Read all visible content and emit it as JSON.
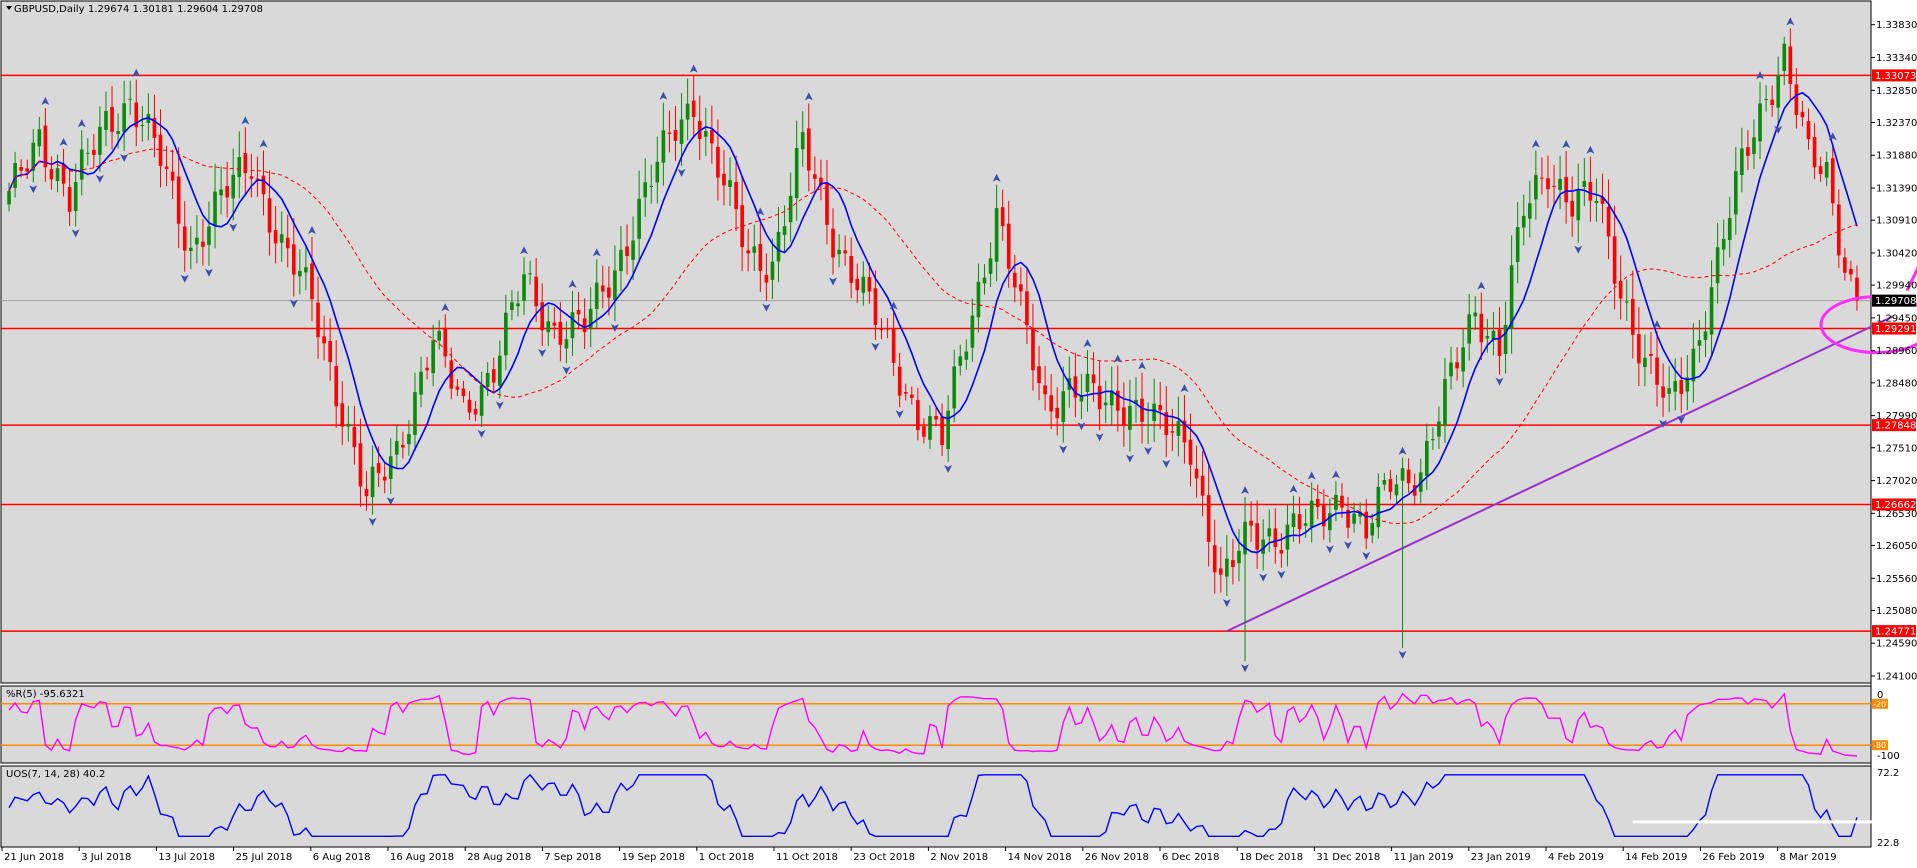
{
  "header": {
    "symbol": "GBPUSD,Daily",
    "ohlc": "1.29674 1.30181 1.29604 1.29708"
  },
  "colors": {
    "background": "#d9d9d9",
    "bull": "#0b8a0b",
    "bear": "#ff0000",
    "ma": "#0000ff",
    "ma_slow": "#ff0000",
    "level_line": "#ff0000",
    "trendline": "#9932cc",
    "annotation": "#ff2cff",
    "wpr_line": "#ff00ff",
    "wpr_level": "#ff8c00",
    "uos_line": "#0000ff"
  },
  "chart_data": [
    {
      "type": "candlestick",
      "title": "GBPUSD,Daily",
      "ylim": [
        1.241,
        1.3405
      ],
      "y_ticks": [
        "1.33830",
        "1.33340",
        "1.32850",
        "1.32370",
        "1.31880",
        "1.31390",
        "1.30910",
        "1.30420",
        "1.29940",
        "1.29450",
        "1.28960",
        "1.28480",
        "1.27990",
        "1.27510",
        "1.27020",
        "1.26530",
        "1.26050",
        "1.25560",
        "1.25080",
        "1.24590",
        "1.24100"
      ],
      "x_ticks": [
        "21 Jun 2018",
        "3 Jul 2018",
        "13 Jul 2018",
        "25 Jul 2018",
        "6 Aug 2018",
        "16 Aug 2018",
        "28 Aug 2018",
        "7 Sep 2018",
        "19 Sep 2018",
        "1 Oct 2018",
        "11 Oct 2018",
        "23 Oct 2018",
        "2 Nov 2018",
        "14 Nov 2018",
        "26 Nov 2018",
        "6 Dec 2018",
        "18 Dec 2018",
        "31 Dec 2018",
        "11 Jan 2019",
        "23 Jan 2019",
        "4 Feb 2019",
        "14 Feb 2019",
        "26 Feb 2019",
        "8 Mar 2019"
      ],
      "price_labels": [
        {
          "label": "1.33073",
          "value": 1.33073,
          "color": "#ff0000"
        },
        {
          "label": "1.29708",
          "value": 1.29708,
          "color": "#000000"
        },
        {
          "label": "1.29291",
          "value": 1.29291,
          "color": "#ff0000"
        },
        {
          "label": "1.27848",
          "value": 1.27848,
          "color": "#ff0000"
        },
        {
          "label": "1.26662",
          "value": 1.26662,
          "color": "#ff0000"
        },
        {
          "label": "1.24771",
          "value": 1.24771,
          "color": "#ff0000"
        }
      ],
      "levels": [
        1.33073,
        1.29291,
        1.27848,
        1.26662,
        1.24771
      ],
      "current_price": 1.29708,
      "anchors": [
        [
          0,
          1.312
        ],
        [
          5,
          1.322
        ],
        [
          10,
          1.312
        ],
        [
          16,
          1.324
        ],
        [
          20,
          1.327
        ],
        [
          25,
          1.318
        ],
        [
          30,
          1.305
        ],
        [
          35,
          1.312
        ],
        [
          40,
          1.318
        ],
        [
          45,
          1.305
        ],
        [
          50,
          1.297
        ],
        [
          55,
          1.281
        ],
        [
          59,
          1.267
        ],
        [
          64,
          1.275
        ],
        [
          70,
          1.291
        ],
        [
          75,
          1.281
        ],
        [
          80,
          1.287
        ],
        [
          85,
          1.3
        ],
        [
          90,
          1.293
        ],
        [
          95,
          1.293
        ],
        [
          100,
          1.302
        ],
        [
          105,
          1.313
        ],
        [
          110,
          1.323
        ],
        [
          113,
          1.327
        ],
        [
          118,
          1.314
        ],
        [
          122,
          1.304
        ],
        [
          126,
          1.303
        ],
        [
          131,
          1.32
        ],
        [
          136,
          1.307
        ],
        [
          140,
          1.3
        ],
        [
          145,
          1.29
        ],
        [
          150,
          1.28
        ],
        [
          154,
          1.276
        ],
        [
          158,
          1.292
        ],
        [
          163,
          1.31
        ],
        [
          167,
          1.295
        ],
        [
          171,
          1.282
        ],
        [
          175,
          1.284
        ],
        [
          180,
          1.282
        ],
        [
          185,
          1.282
        ],
        [
          190,
          1.278
        ],
        [
          195,
          1.276
        ],
        [
          200,
          1.254
        ],
        [
          205,
          1.263
        ],
        [
          210,
          1.262
        ],
        [
          215,
          1.264
        ],
        [
          220,
          1.268
        ],
        [
          224,
          1.262
        ],
        [
          228,
          1.27
        ],
        [
          233,
          1.272
        ],
        [
          238,
          1.285
        ],
        [
          242,
          1.296
        ],
        [
          246,
          1.29
        ],
        [
          250,
          1.31
        ],
        [
          254,
          1.317
        ],
        [
          258,
          1.312
        ],
        [
          262,
          1.312
        ],
        [
          266,
          1.299
        ],
        [
          270,
          1.288
        ],
        [
          274,
          1.281
        ],
        [
          278,
          1.289
        ],
        [
          282,
          1.303
        ],
        [
          286,
          1.317
        ],
        [
          290,
          1.328
        ],
        [
          293,
          1.334
        ],
        [
          297,
          1.318
        ],
        [
          300,
          1.316
        ],
        [
          303,
          1.303
        ],
        [
          305,
          1.297
        ]
      ],
      "ma_fast_period": "8",
      "ma_slow_period": "34"
    },
    {
      "type": "line",
      "title": "%R(5) -95.6321",
      "ylim": [
        -100,
        0
      ],
      "y_ticks": [
        "0",
        "-100"
      ],
      "levels": [
        -20,
        -80
      ],
      "level_labels": [
        "-20",
        "-80"
      ],
      "last_value": -95.6321
    },
    {
      "type": "line",
      "title": "UOS(7, 14, 28) 40.2",
      "ylim": [
        22.8,
        72.2
      ],
      "y_ticks": [
        "72.2",
        "22.8"
      ],
      "last_value": 40.2
    }
  ]
}
